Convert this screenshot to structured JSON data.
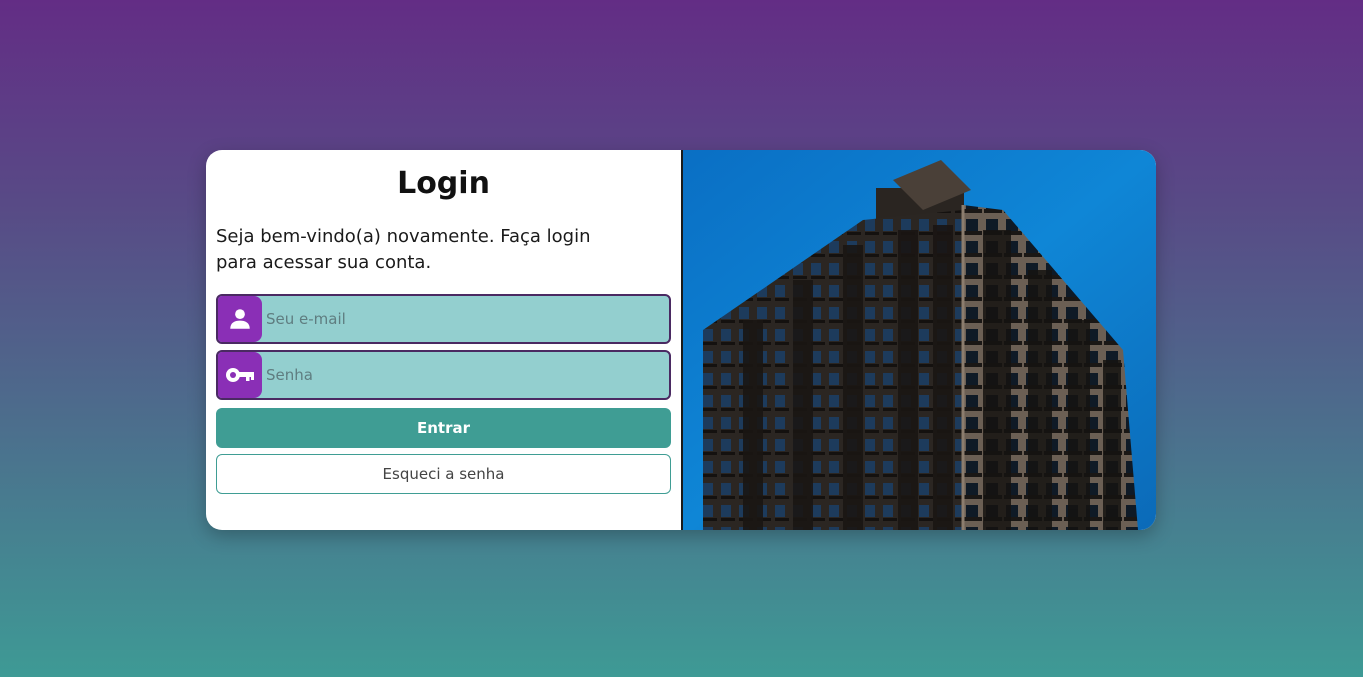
{
  "login": {
    "title": "Login",
    "subtitle": "Seja bem-vindo(a) novamente. Faça login para acessar sua conta.",
    "email": {
      "placeholder": "Seu e-mail",
      "icon": "user-icon"
    },
    "password": {
      "placeholder": "Senha",
      "icon": "key-icon"
    },
    "submit_label": "Entrar",
    "forgot_label": "Esqueci a senha"
  },
  "colors": {
    "accent_purple": "#8a2fb6",
    "accent_teal": "#3f9d94",
    "input_bg": "#93cfcf",
    "sky": "#0a7fd0"
  }
}
